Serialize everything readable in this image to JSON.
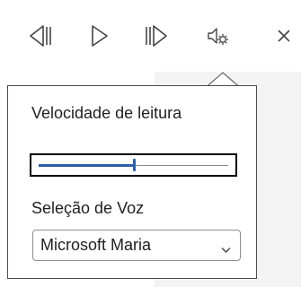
{
  "toolbar": {
    "buttons": [
      {
        "icon": "previous-paragraph-icon"
      },
      {
        "icon": "play-icon"
      },
      {
        "icon": "next-paragraph-icon"
      },
      {
        "icon": "voice-settings-icon"
      },
      {
        "icon": "close-icon"
      }
    ]
  },
  "settings": {
    "speed_label": "Velocidade de leitura",
    "speed_value": 0.5,
    "voice_label": "Seleção de Voz",
    "voice_selected": "Microsoft Maria"
  },
  "colors": {
    "accent": "#2f5fa6"
  }
}
